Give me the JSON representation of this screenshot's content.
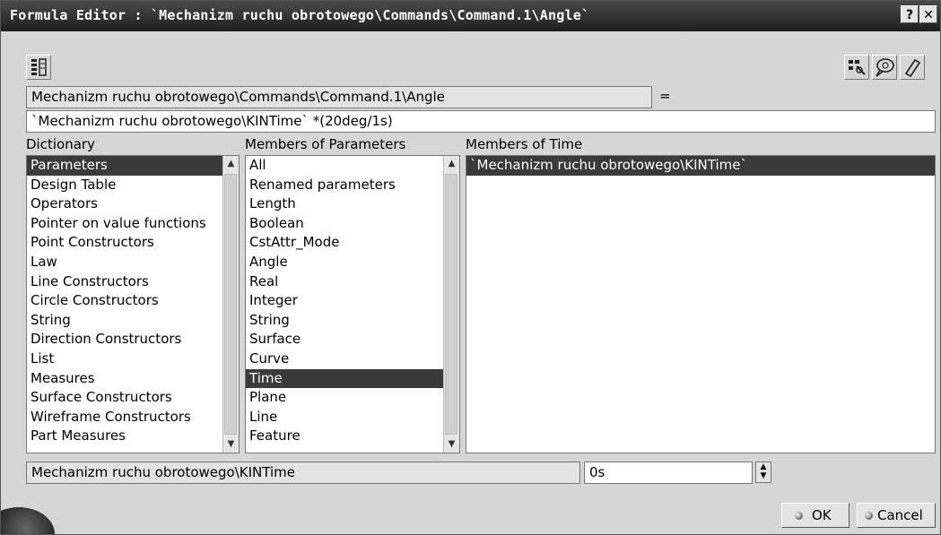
{
  "window": {
    "title": "Formula Editor :  `Mechanizm ruchu obrotowego\\Commands\\Command.1\\Angle`",
    "help_glyph": "?",
    "close_glyph": "✕"
  },
  "toolbar": {
    "icons": [
      "import-formula-icon",
      "parameter-filter-icon",
      "speech-bubble-icon",
      "eraser-icon"
    ]
  },
  "parameter_field": {
    "value": "Mechanizm ruchu obrotowego\\Commands\\Command.1\\Angle",
    "equals": "="
  },
  "formula_input": {
    "value": "`Mechanizm ruchu obrotowego\\KINTime` *(20deg/1s)"
  },
  "dictionary": {
    "header": "Dictionary",
    "items": [
      "Parameters",
      "Design Table",
      "Operators",
      "Pointer on value functions",
      "Point Constructors",
      "Law",
      "Line Constructors",
      "Circle Constructors",
      "String",
      "Direction Constructors",
      "List",
      "Measures",
      "Surface Constructors",
      "Wireframe Constructors",
      "Part Measures"
    ],
    "selected": 0
  },
  "members_of_parameters": {
    "header": "Members of Parameters",
    "items": [
      "All",
      "Renamed parameters",
      "Length",
      "Boolean",
      "CstAttr_Mode",
      "Angle",
      "Real",
      "Integer",
      "String",
      "Surface",
      "Curve",
      "Time",
      "Plane",
      "Line",
      "Feature"
    ],
    "selected": 11
  },
  "members_of_time": {
    "header": "Members of Time",
    "items": [
      "`Mechanizm ruchu obrotowego\\KINTime`"
    ],
    "selected": 0
  },
  "bottom": {
    "selected_name": "Mechanizm ruchu obrotowego\\KINTime",
    "value": "0s"
  },
  "buttons": {
    "ok": "OK",
    "cancel": "Cancel"
  }
}
